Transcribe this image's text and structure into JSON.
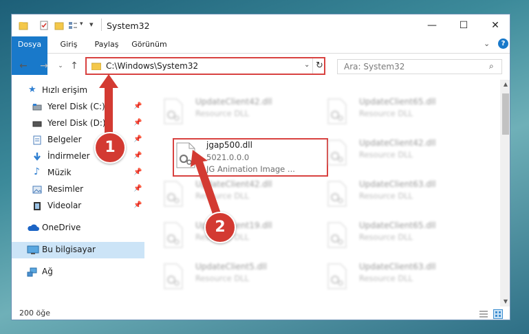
{
  "window": {
    "title": "System32"
  },
  "window_controls": {
    "minimize": "—",
    "maximize": "☐",
    "close": "✕"
  },
  "ribbon": {
    "tabs": [
      "Dosya",
      "Giriş",
      "Paylaş",
      "Görünüm"
    ]
  },
  "address": {
    "path": "C:\\Windows\\System32"
  },
  "search": {
    "placeholder": "Ara: System32"
  },
  "nav": {
    "items": [
      {
        "label": "Hızlı erişim",
        "icon": "star-icon",
        "pinned": false
      },
      {
        "label": "Yerel Disk (C:)",
        "icon": "drive-icon",
        "pinned": true
      },
      {
        "label": "Yerel Disk (D:)",
        "icon": "drive-icon",
        "pinned": true
      },
      {
        "label": "Belgeler",
        "icon": "documents-icon",
        "pinned": true
      },
      {
        "label": "İndirmeler",
        "icon": "download-icon",
        "pinned": true
      },
      {
        "label": "Müzik",
        "icon": "music-icon",
        "pinned": true
      },
      {
        "label": "Resimler",
        "icon": "pictures-icon",
        "pinned": true
      },
      {
        "label": "Videolar",
        "icon": "video-icon",
        "pinned": true
      },
      {
        "label": "OneDrive",
        "icon": "cloud-icon",
        "pinned": false
      },
      {
        "label": "Bu bilgisayar",
        "icon": "computer-icon",
        "pinned": false,
        "selected": true
      },
      {
        "label": "Ağ",
        "icon": "network-icon",
        "pinned": false
      }
    ]
  },
  "files": [
    {
      "name": "UpdateClient42.dll",
      "sub": "Resource DLL",
      "blurred": true
    },
    {
      "name": "UpdateClient65.dll",
      "sub": "Resource DLL",
      "blurred": true
    },
    {
      "name": "jgap500.dll",
      "sub": "5021.0.0.0",
      "sub2": "JG Animation Image ...",
      "blurred": false
    },
    {
      "name": "UpdateClient42.dll",
      "sub": "Resource DLL",
      "blurred": true
    },
    {
      "name": "UpdateClient42.dll",
      "sub": "Resource DLL",
      "blurred": true
    },
    {
      "name": "UpdateClient63.dll",
      "sub": "Resource DLL",
      "blurred": true
    },
    {
      "name": "UpdateClient19.dll",
      "sub": "Resource DLL",
      "blurred": true
    },
    {
      "name": "UpdateClient65.dll",
      "sub": "Resource DLL",
      "blurred": true
    },
    {
      "name": "UpdateClient5.dll",
      "sub": "Resource DLL",
      "blurred": true
    },
    {
      "name": "UpdateClient63.dll",
      "sub": "Resource DLL",
      "blurred": true
    }
  ],
  "status": {
    "count": "200 öğe"
  },
  "callouts": [
    "1",
    "2"
  ],
  "colors": {
    "accent": "#1979ca",
    "highlight": "#d8413f",
    "selected": "#cce4f7"
  }
}
